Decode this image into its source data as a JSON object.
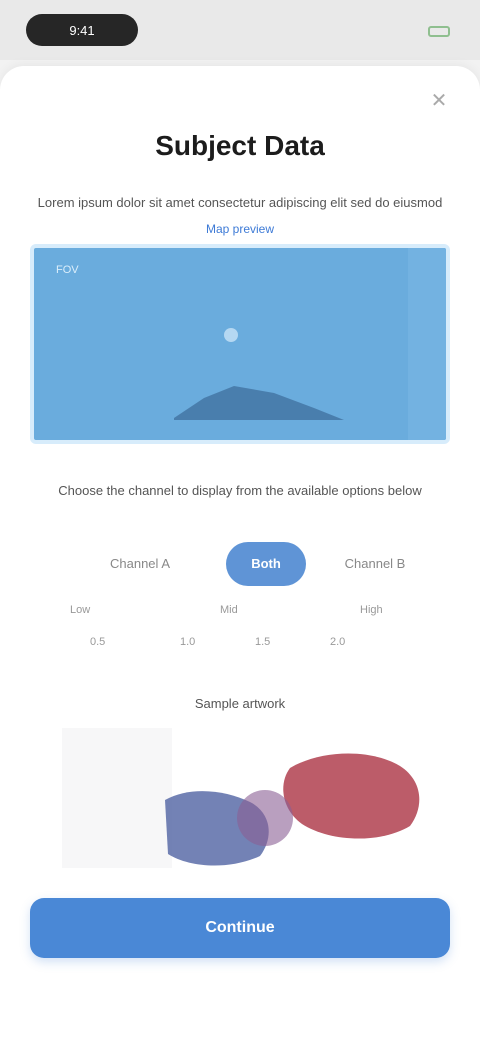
{
  "status_bar": {
    "time": "9:41"
  },
  "sheet": {
    "title": "Subject Data",
    "close_label": "✕",
    "description": "Lorem ipsum dolor sit amet consectetur adipiscing elit sed do eiusmod",
    "preview_label": "Map preview",
    "preview_corner_label": "FOV",
    "preview_color": "#6aacdd",
    "selector_description": "Choose the channel to display from the available options below",
    "selector": {
      "options": [
        "Channel A",
        "Both",
        "Channel B"
      ],
      "selected": "Both"
    },
    "captions": [
      "Low",
      "Mid",
      "High"
    ],
    "option_labels": [
      "0.5",
      "1.0",
      "1.5",
      "2.0"
    ],
    "sample_label": "Sample artwork",
    "primary_button": "Continue",
    "accent_color": "#4a88d6"
  }
}
